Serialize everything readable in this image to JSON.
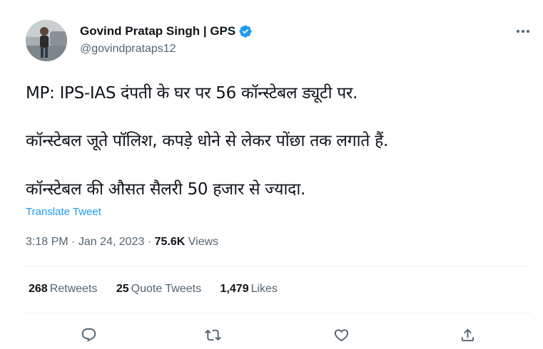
{
  "author": {
    "name": "Govind Pratap Singh | GPS",
    "handle": "@govindprataps12",
    "verified": true
  },
  "tweet": {
    "lines": [
      "MP: IPS-IAS दंपती के घर पर 56 कॉन्स्टेबल ड्यूटी पर.",
      "कॉन्स्टेबल जूते पॉलिश, कपड़े धोने से लेकर पोंछा तक लगाते हैं.",
      "कॉन्स्टेबल की औसत सैलरी 50 हजार से ज्यादा."
    ],
    "translate_label": "Translate Tweet"
  },
  "meta": {
    "time": "3:18 PM",
    "separator": "·",
    "date": "Jan 24, 2023",
    "views_count": "75.6K",
    "views_label": "Views"
  },
  "stats": {
    "retweets_count": "268",
    "retweets_label": "Retweets",
    "quotes_count": "25",
    "quotes_label": "Quote Tweets",
    "likes_count": "1,479",
    "likes_label": "Likes"
  },
  "colors": {
    "accent": "#1d9bf0",
    "secondary_text": "#536471",
    "divider": "#eff3f4"
  },
  "icons": [
    "more-icon",
    "verified-badge-icon",
    "reply-icon",
    "retweet-icon",
    "like-icon",
    "share-icon"
  ]
}
